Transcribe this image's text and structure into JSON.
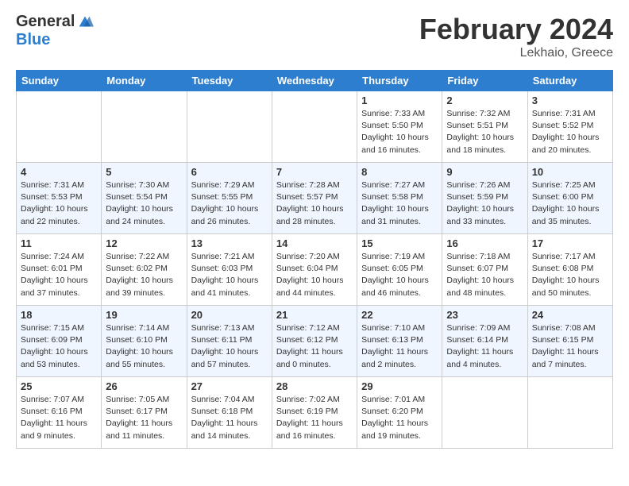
{
  "header": {
    "logo_general": "General",
    "logo_blue": "Blue",
    "month_title": "February 2024",
    "location": "Lekhaio, Greece"
  },
  "columns": [
    "Sunday",
    "Monday",
    "Tuesday",
    "Wednesday",
    "Thursday",
    "Friday",
    "Saturday"
  ],
  "weeks": [
    {
      "days": [
        {
          "num": "",
          "info": ""
        },
        {
          "num": "",
          "info": ""
        },
        {
          "num": "",
          "info": ""
        },
        {
          "num": "",
          "info": ""
        },
        {
          "num": "1",
          "info": "Sunrise: 7:33 AM\nSunset: 5:50 PM\nDaylight: 10 hours\nand 16 minutes."
        },
        {
          "num": "2",
          "info": "Sunrise: 7:32 AM\nSunset: 5:51 PM\nDaylight: 10 hours\nand 18 minutes."
        },
        {
          "num": "3",
          "info": "Sunrise: 7:31 AM\nSunset: 5:52 PM\nDaylight: 10 hours\nand 20 minutes."
        }
      ]
    },
    {
      "days": [
        {
          "num": "4",
          "info": "Sunrise: 7:31 AM\nSunset: 5:53 PM\nDaylight: 10 hours\nand 22 minutes."
        },
        {
          "num": "5",
          "info": "Sunrise: 7:30 AM\nSunset: 5:54 PM\nDaylight: 10 hours\nand 24 minutes."
        },
        {
          "num": "6",
          "info": "Sunrise: 7:29 AM\nSunset: 5:55 PM\nDaylight: 10 hours\nand 26 minutes."
        },
        {
          "num": "7",
          "info": "Sunrise: 7:28 AM\nSunset: 5:57 PM\nDaylight: 10 hours\nand 28 minutes."
        },
        {
          "num": "8",
          "info": "Sunrise: 7:27 AM\nSunset: 5:58 PM\nDaylight: 10 hours\nand 31 minutes."
        },
        {
          "num": "9",
          "info": "Sunrise: 7:26 AM\nSunset: 5:59 PM\nDaylight: 10 hours\nand 33 minutes."
        },
        {
          "num": "10",
          "info": "Sunrise: 7:25 AM\nSunset: 6:00 PM\nDaylight: 10 hours\nand 35 minutes."
        }
      ]
    },
    {
      "days": [
        {
          "num": "11",
          "info": "Sunrise: 7:24 AM\nSunset: 6:01 PM\nDaylight: 10 hours\nand 37 minutes."
        },
        {
          "num": "12",
          "info": "Sunrise: 7:22 AM\nSunset: 6:02 PM\nDaylight: 10 hours\nand 39 minutes."
        },
        {
          "num": "13",
          "info": "Sunrise: 7:21 AM\nSunset: 6:03 PM\nDaylight: 10 hours\nand 41 minutes."
        },
        {
          "num": "14",
          "info": "Sunrise: 7:20 AM\nSunset: 6:04 PM\nDaylight: 10 hours\nand 44 minutes."
        },
        {
          "num": "15",
          "info": "Sunrise: 7:19 AM\nSunset: 6:05 PM\nDaylight: 10 hours\nand 46 minutes."
        },
        {
          "num": "16",
          "info": "Sunrise: 7:18 AM\nSunset: 6:07 PM\nDaylight: 10 hours\nand 48 minutes."
        },
        {
          "num": "17",
          "info": "Sunrise: 7:17 AM\nSunset: 6:08 PM\nDaylight: 10 hours\nand 50 minutes."
        }
      ]
    },
    {
      "days": [
        {
          "num": "18",
          "info": "Sunrise: 7:15 AM\nSunset: 6:09 PM\nDaylight: 10 hours\nand 53 minutes."
        },
        {
          "num": "19",
          "info": "Sunrise: 7:14 AM\nSunset: 6:10 PM\nDaylight: 10 hours\nand 55 minutes."
        },
        {
          "num": "20",
          "info": "Sunrise: 7:13 AM\nSunset: 6:11 PM\nDaylight: 10 hours\nand 57 minutes."
        },
        {
          "num": "21",
          "info": "Sunrise: 7:12 AM\nSunset: 6:12 PM\nDaylight: 11 hours\nand 0 minutes."
        },
        {
          "num": "22",
          "info": "Sunrise: 7:10 AM\nSunset: 6:13 PM\nDaylight: 11 hours\nand 2 minutes."
        },
        {
          "num": "23",
          "info": "Sunrise: 7:09 AM\nSunset: 6:14 PM\nDaylight: 11 hours\nand 4 minutes."
        },
        {
          "num": "24",
          "info": "Sunrise: 7:08 AM\nSunset: 6:15 PM\nDaylight: 11 hours\nand 7 minutes."
        }
      ]
    },
    {
      "days": [
        {
          "num": "25",
          "info": "Sunrise: 7:07 AM\nSunset: 6:16 PM\nDaylight: 11 hours\nand 9 minutes."
        },
        {
          "num": "26",
          "info": "Sunrise: 7:05 AM\nSunset: 6:17 PM\nDaylight: 11 hours\nand 11 minutes."
        },
        {
          "num": "27",
          "info": "Sunrise: 7:04 AM\nSunset: 6:18 PM\nDaylight: 11 hours\nand 14 minutes."
        },
        {
          "num": "28",
          "info": "Sunrise: 7:02 AM\nSunset: 6:19 PM\nDaylight: 11 hours\nand 16 minutes."
        },
        {
          "num": "29",
          "info": "Sunrise: 7:01 AM\nSunset: 6:20 PM\nDaylight: 11 hours\nand 19 minutes."
        },
        {
          "num": "",
          "info": ""
        },
        {
          "num": "",
          "info": ""
        }
      ]
    }
  ]
}
